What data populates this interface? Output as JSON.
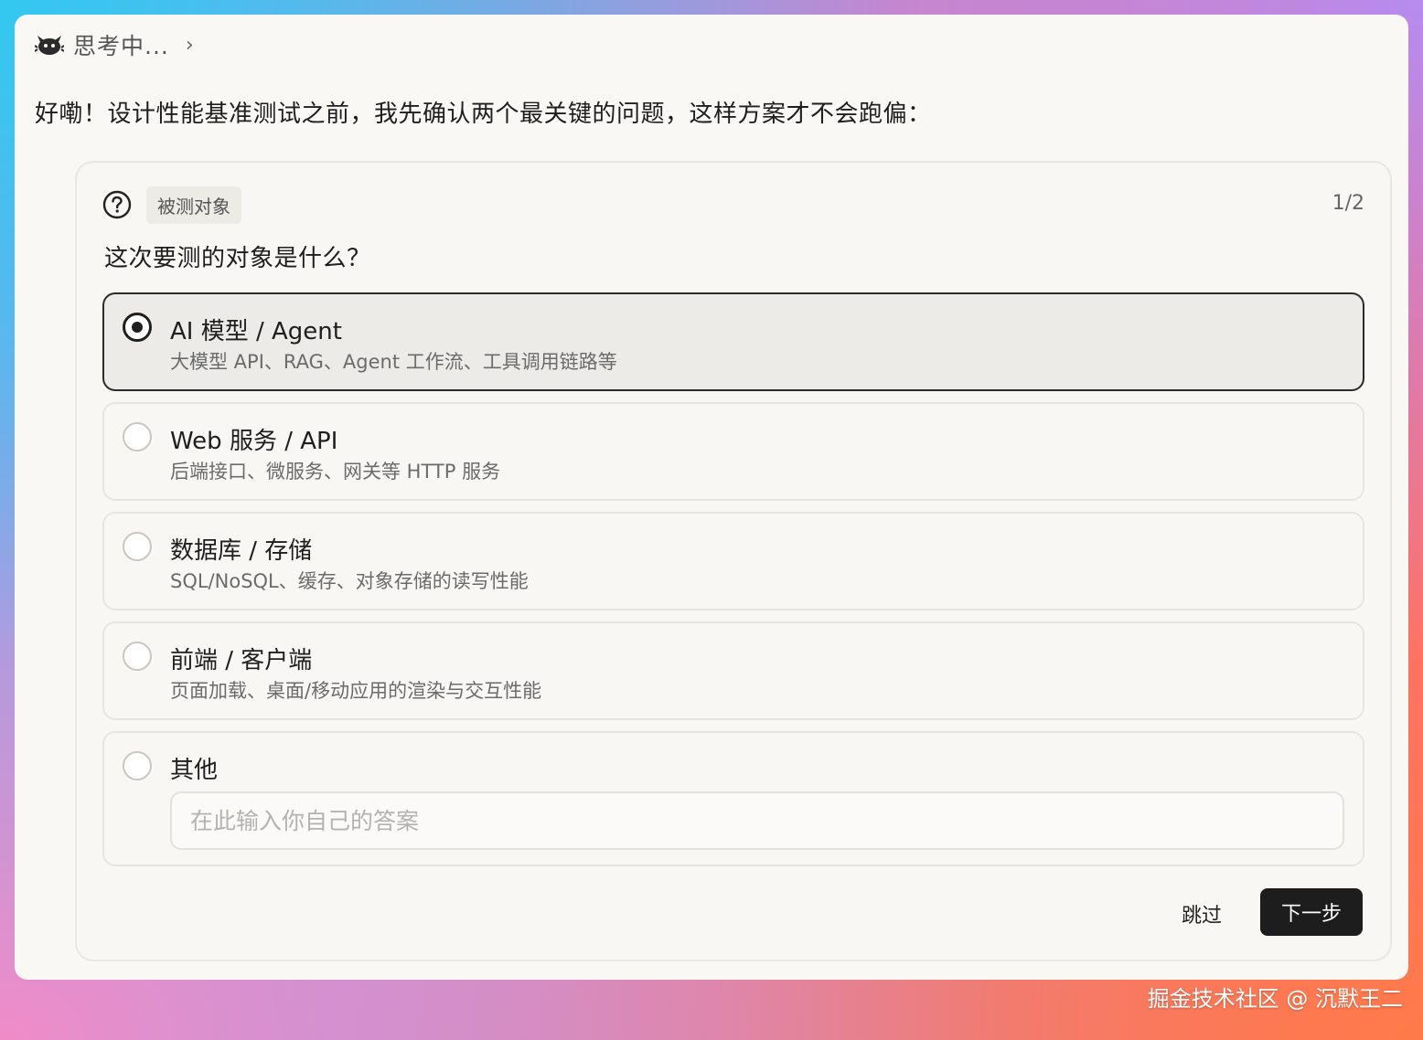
{
  "thinking": {
    "label": "思考中...",
    "icon": "bot-icon",
    "chevron_icon": "chevron-right-icon"
  },
  "intro": "好嘞！设计性能基准测试之前，我先确认两个最关键的问题，这样方案才不会跑偏：",
  "card": {
    "icon": "question-circle-icon",
    "tag": "被测对象",
    "counter": "1/2",
    "question": "这次要测的对象是什么？",
    "options": [
      {
        "title": "AI 模型 / Agent",
        "desc": "大模型 API、RAG、Agent 工作流、工具调用链路等",
        "selected": true
      },
      {
        "title": "Web 服务 / API",
        "desc": "后端接口、微服务、网关等 HTTP 服务",
        "selected": false
      },
      {
        "title": "数据库 / 存储",
        "desc": "SQL/NoSQL、缓存、对象存储的读写性能",
        "selected": false
      },
      {
        "title": "前端 / 客户端",
        "desc": "页面加载、桌面/移动应用的渲染与交互性能",
        "selected": false
      }
    ],
    "other": {
      "title": "其他",
      "placeholder": "在此输入你自己的答案",
      "value": ""
    },
    "skip_label": "跳过",
    "next_label": "下一步"
  },
  "watermark": "掘金技术社区 @ 沉默王二",
  "colors": {
    "primary_button": "#1d1d1d",
    "selected_border": "#2b2b2b",
    "window_bg": "#f9f8f5"
  }
}
